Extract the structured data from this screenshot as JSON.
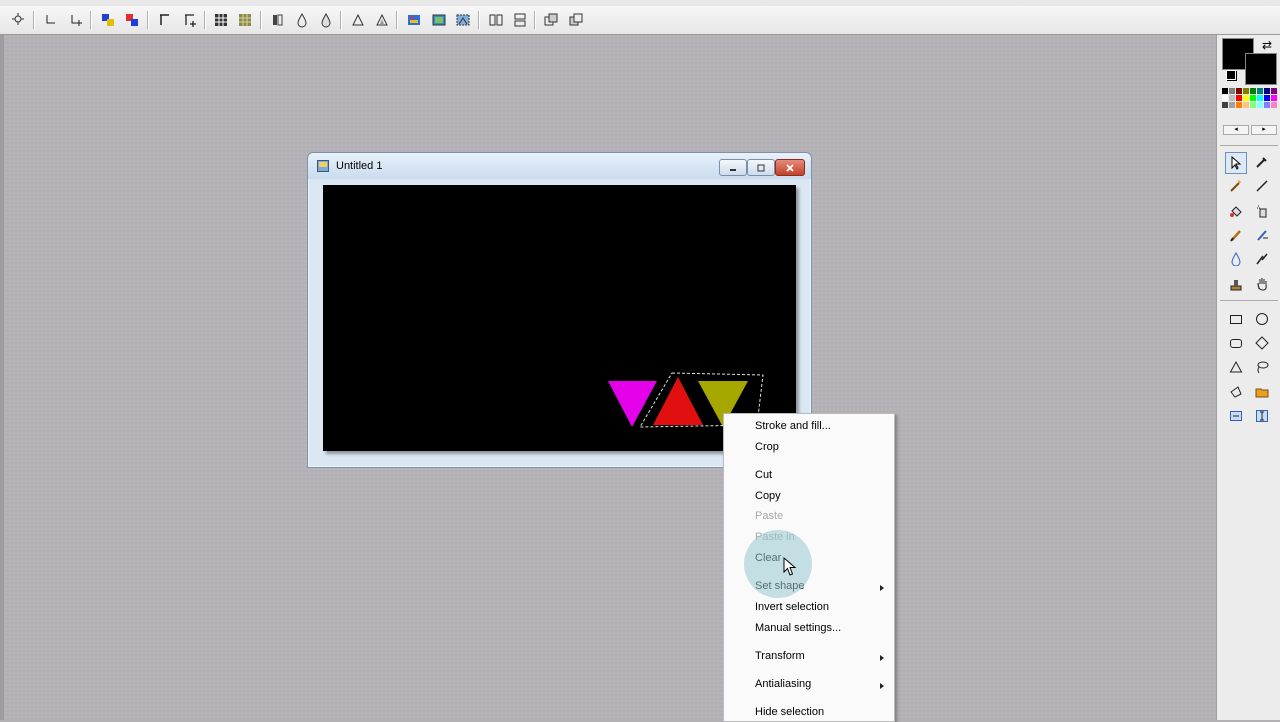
{
  "document": {
    "title": "Untitled 1"
  },
  "colors": {
    "canvas_bg": "#000000",
    "magenta_triangle": "#e400e8",
    "red_triangle": "#e01010",
    "olive_triangle": "#a6a800",
    "foreground_color": "#000000",
    "background_color": "#000000"
  },
  "context_menu": {
    "items": [
      {
        "label": "Stroke and fill...",
        "enabled": true
      },
      {
        "label": "Crop",
        "enabled": true
      },
      {
        "label": "Cut",
        "enabled": true
      },
      {
        "label": "Copy",
        "enabled": true
      },
      {
        "label": "Paste",
        "enabled": false
      },
      {
        "label": "Paste in",
        "enabled": false
      },
      {
        "label": "Clear",
        "enabled": true
      },
      {
        "label": "Set shape",
        "enabled": true,
        "submenu": true
      },
      {
        "label": "Invert selection",
        "enabled": true
      },
      {
        "label": "Manual settings...",
        "enabled": true
      },
      {
        "label": "Transform",
        "enabled": true,
        "submenu": true
      },
      {
        "label": "Antialiasing",
        "enabled": true,
        "submenu": true
      },
      {
        "label": "Hide selection",
        "enabled": true
      }
    ]
  },
  "toolbar_icons": [
    "selection-icon",
    "shape-left-icon",
    "shape-right-icon",
    "color-left-icon",
    "color-right-icon",
    "align-left-icon",
    "align-right-icon",
    "grid-icon",
    "pattern-icon",
    "mirror-icon",
    "drop-icon",
    "drop-outline-icon",
    "triangle-icon",
    "triangle-outline-icon",
    "image-icon",
    "image-frame-icon",
    "image-select-icon",
    "split-icon",
    "split-horizontal-icon",
    "layers-icon",
    "layers-swap-icon"
  ],
  "tools": [
    "select-arrow-icon",
    "eyedropper-icon",
    "magic-wand-icon",
    "line-icon",
    "fill-bucket-icon",
    "spray-icon",
    "brush-icon",
    "pen-icon",
    "drop-icon",
    "retouch-icon",
    "stamp-icon",
    "hand-icon",
    "rectangle-icon",
    "ellipse-icon",
    "rounded-rectangle-icon",
    "diamond-icon",
    "triangle-icon",
    "lasso-icon",
    "polygon-icon",
    "folder-icon",
    "text-icon",
    "text-cursor-icon"
  ]
}
